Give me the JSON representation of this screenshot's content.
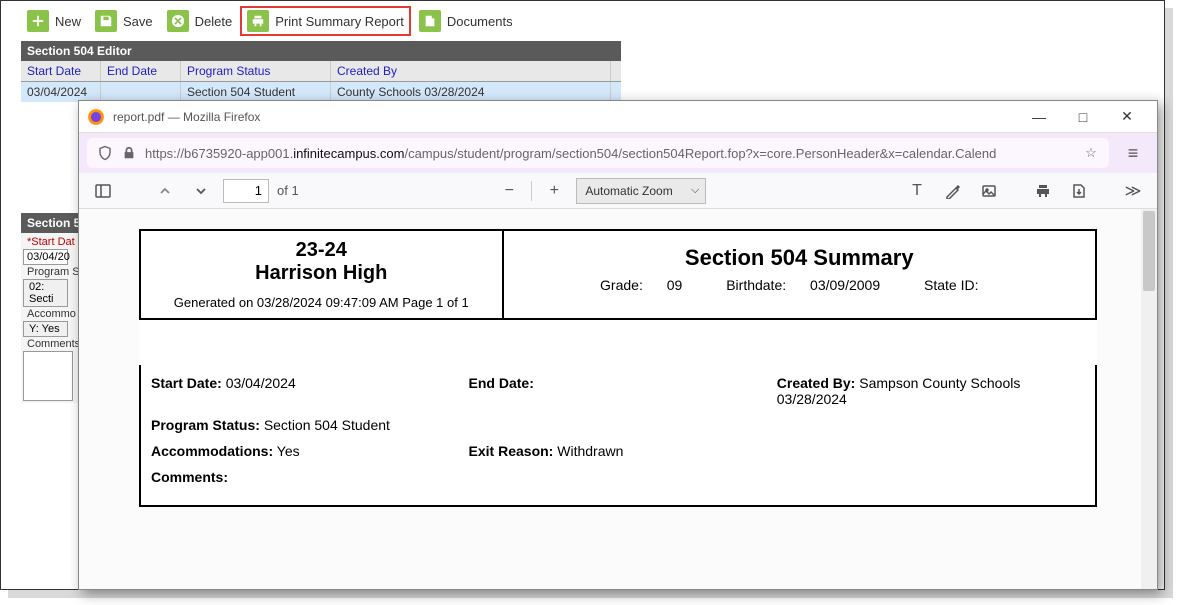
{
  "toolbar": {
    "new": "New",
    "save": "Save",
    "delete": "Delete",
    "print": "Print Summary Report",
    "documents": "Documents"
  },
  "editor": {
    "title": "Section 504 Editor",
    "headers": {
      "start": "Start Date",
      "end": "End Date",
      "status": "Program Status",
      "created": "Created By"
    },
    "row": {
      "start": "03/04/2024",
      "end": "",
      "status": "Section 504 Student",
      "created": "County Schools 03/28/2024"
    }
  },
  "detail": {
    "title": "Section 5",
    "start_label": "*Start Dat",
    "start_val": "03/04/20",
    "prog_label": "Program S",
    "prog_val": "02: Secti",
    "accom_label": "Accommo",
    "accom_val": "Y: Yes",
    "comments_label": "Comments"
  },
  "window": {
    "title": "report.pdf — Mozilla Firefox",
    "url_prefix": "https://b6735920-app001.",
    "url_domain": "infinitecampus.com",
    "url_path": "/campus/student/program/section504/section504Report.fop?x=core.PersonHeader&x=calendar.Calend"
  },
  "pdf": {
    "page": "1",
    "of": "of 1",
    "zoom": "Automatic Zoom"
  },
  "report": {
    "year": "23-24",
    "school": "Harrison High",
    "generated": "Generated on 03/28/2024 09:47:09 AM    Page 1 of  1",
    "title": "Section 504 Summary",
    "grade_label": "Grade:",
    "grade": "09",
    "birth_label": "Birthdate:",
    "birth": "03/09/2009",
    "stateid_label": "State ID:",
    "stateid": "",
    "sd_label": "Start Date:",
    "sd": "03/04/2024",
    "ed_label": "End Date:",
    "ed": "",
    "cb_label": "Created By:",
    "cb": "Sampson County Schools 03/28/2024",
    "ps_label": "Program Status:",
    "ps": "Section 504 Student",
    "ac_label": "Accommodations:",
    "ac": "Yes",
    "er_label": "Exit Reason:",
    "er": "Withdrawn",
    "cm_label": "Comments:",
    "cm": ""
  }
}
